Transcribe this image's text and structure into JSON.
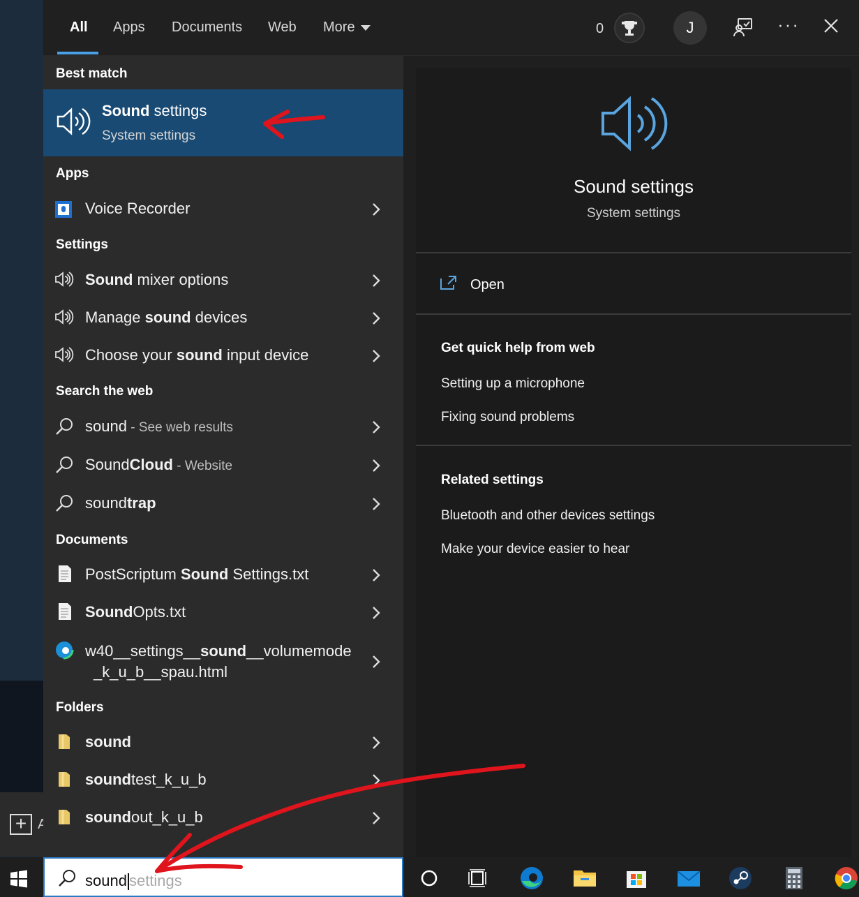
{
  "tabs": [
    "All",
    "Apps",
    "Documents",
    "Web",
    "More"
  ],
  "header": {
    "points": "0",
    "avatar_initial": "J"
  },
  "best_match": {
    "header": "Best match",
    "title_bold": "Sound",
    "title_rest": " settings",
    "subtitle": "System settings"
  },
  "sections": {
    "apps": "Apps",
    "settings": "Settings",
    "web": "Search the web",
    "documents": "Documents",
    "folders": "Folders"
  },
  "apps": [
    {
      "label": "Voice Recorder"
    }
  ],
  "settings": [
    {
      "pre": "",
      "bold": "Sound",
      "post": " mixer options"
    },
    {
      "pre": "Manage ",
      "bold": "sound",
      "post": " devices"
    },
    {
      "pre": "Choose your ",
      "bold": "sound",
      "post": " input device"
    }
  ],
  "web": [
    {
      "pre": "sound",
      "bold": "",
      "muted": " - See web results"
    },
    {
      "pre": "Sound",
      "bold": "Cloud",
      "muted": " - Website"
    },
    {
      "pre": "sound",
      "bold": "trap",
      "muted": ""
    }
  ],
  "documents": [
    {
      "pre": "PostScriptum ",
      "bold": "Sound",
      "post": " Settings.txt"
    },
    {
      "pre": "",
      "bold": "Sound",
      "post": "Opts.txt"
    },
    {
      "line1_pre": "w40__settings__",
      "line1_bold": "sound",
      "line1_post": "__volumemode",
      "line2": "_k_u_b__spau.html"
    }
  ],
  "folders": [
    {
      "pre": "",
      "bold": "sound",
      "post": ""
    },
    {
      "pre": "",
      "bold": "sound",
      "post": "test_k_u_b"
    },
    {
      "pre": "",
      "bold": "sound",
      "post": "out_k_u_b"
    }
  ],
  "preview": {
    "title": "Sound settings",
    "subtitle": "System settings",
    "open_label": "Open",
    "help_header": "Get quick help from web",
    "help_links": [
      "Setting up a microphone",
      "Fixing sound problems"
    ],
    "related_header": "Related settings",
    "related_links": [
      "Bluetooth and other devices settings",
      "Make your device easier to hear"
    ]
  },
  "search": {
    "typed": "sound",
    "suggestion": "settings"
  },
  "desktop": {
    "partial_label": "A"
  },
  "colors": {
    "accent": "#4aa0e6",
    "selected_bg": "#194a73",
    "annotation": "#e0141c"
  },
  "taskbar_icons": [
    "cortana-circle-icon",
    "task-view-icon",
    "edge-icon",
    "file-explorer-icon",
    "store-icon",
    "mail-icon",
    "steam-icon",
    "calculator-icon",
    "chrome-icon"
  ]
}
